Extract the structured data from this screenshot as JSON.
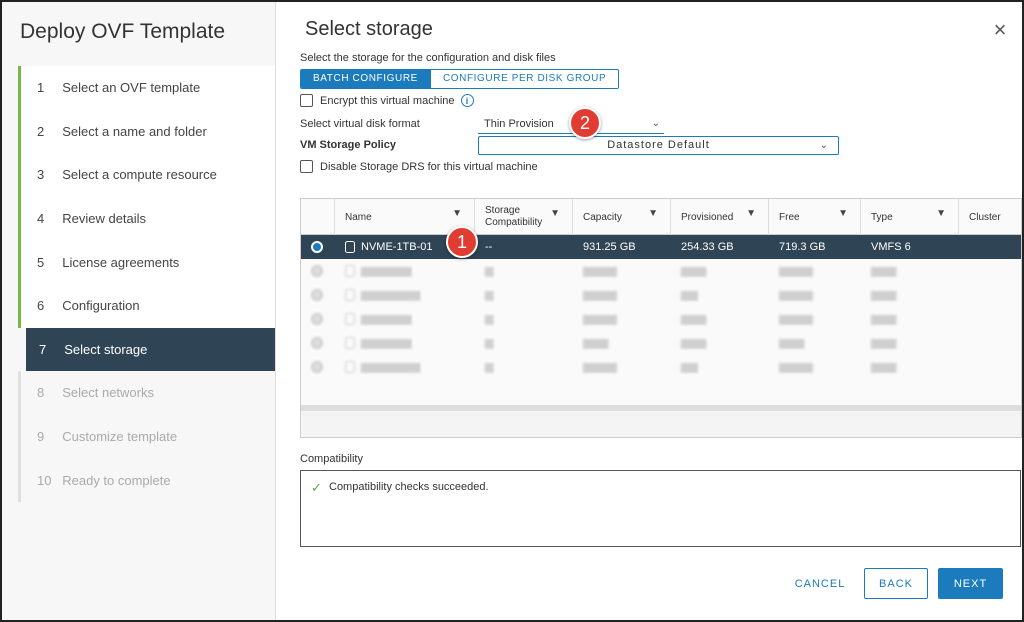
{
  "sidebar": {
    "title": "Deploy OVF Template",
    "steps": [
      {
        "num": "1",
        "label": "Select an OVF template"
      },
      {
        "num": "2",
        "label": "Select a name and folder"
      },
      {
        "num": "3",
        "label": "Select a compute resource"
      },
      {
        "num": "4",
        "label": "Review details"
      },
      {
        "num": "5",
        "label": "License agreements"
      },
      {
        "num": "6",
        "label": "Configuration"
      },
      {
        "num": "7",
        "label": "Select storage"
      },
      {
        "num": "8",
        "label": "Select networks"
      },
      {
        "num": "9",
        "label": "Customize template"
      },
      {
        "num": "10",
        "label": "Ready to complete"
      }
    ]
  },
  "main": {
    "title": "Select storage",
    "subtitle": "Select the storage for the configuration and disk files",
    "tabs": {
      "batch": "BATCH CONFIGURE",
      "per_disk": "CONFIGURE PER DISK GROUP"
    },
    "encrypt_label": "Encrypt this virtual machine",
    "disk_format_label": "Select virtual disk format",
    "disk_format_value": "Thin Provision",
    "policy_label": "VM Storage Policy",
    "policy_value": "Datastore Default",
    "disable_drs_label": "Disable Storage DRS for this virtual machine"
  },
  "table": {
    "headers": {
      "name": "Name",
      "storage_compat_1": "Storage",
      "storage_compat_2": "Compatibility",
      "capacity": "Capacity",
      "provisioned": "Provisioned",
      "free": "Free",
      "type": "Type",
      "cluster": "Cluster"
    },
    "selected_row": {
      "name": "NVME-1TB-01",
      "compat": "--",
      "capacity": "931.25 GB",
      "provisioned": "254.33 GB",
      "free": "719.3 GB",
      "type": "VMFS 6"
    }
  },
  "compatibility": {
    "label": "Compatibility",
    "message": "Compatibility checks succeeded."
  },
  "buttons": {
    "cancel": "CANCEL",
    "back": "BACK",
    "next": "NEXT"
  },
  "badges": {
    "one": "1",
    "two": "2"
  },
  "colors": {
    "accent": "#1b7bbd",
    "selected": "#2f4555",
    "done": "#7ab648",
    "badge": "#e03c31"
  }
}
